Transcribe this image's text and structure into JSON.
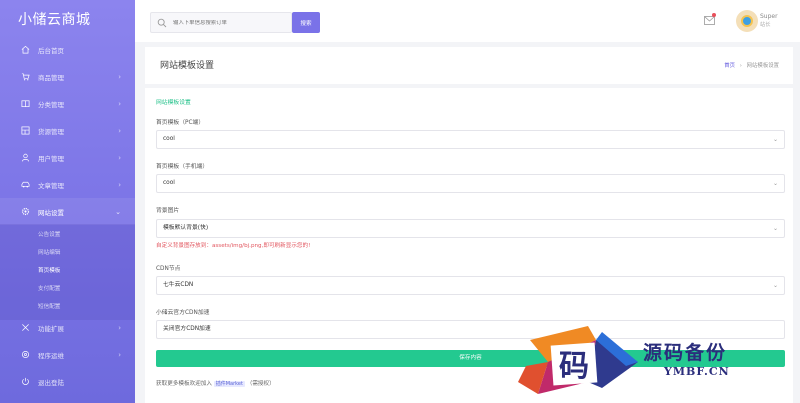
{
  "brand": "小储云商城",
  "sidebar": {
    "items": [
      {
        "label": "后台首页",
        "icon": "home-icon",
        "has_arrow": false
      },
      {
        "label": "商品管理",
        "icon": "cart-icon",
        "has_arrow": true
      },
      {
        "label": "分类管理",
        "icon": "book-icon",
        "has_arrow": true
      },
      {
        "label": "货源管理",
        "icon": "grid-icon",
        "has_arrow": true
      },
      {
        "label": "用户管理",
        "icon": "user-icon",
        "has_arrow": true
      },
      {
        "label": "文章管理",
        "icon": "car-icon",
        "has_arrow": true
      },
      {
        "label": "网站设置",
        "icon": "gear-icon",
        "has_arrow": true
      }
    ],
    "sub_items": [
      "公告设置",
      "网站编辑",
      "首页模板",
      "支付配置",
      "短信配置"
    ],
    "bottom_items": [
      {
        "label": "功能扩展",
        "icon": "tools-icon",
        "has_arrow": true
      },
      {
        "label": "程序运维",
        "icon": "settings-icon",
        "has_arrow": true
      },
      {
        "label": "退出登陆",
        "icon": "power-icon",
        "has_arrow": false
      }
    ],
    "arrow": "›",
    "arrow_open": "⌄"
  },
  "header": {
    "search_placeholder": "输入下单信息搜索订单",
    "search_button": "搜索",
    "user_name": "Super",
    "user_role": "站长"
  },
  "page": {
    "title": "网站模板设置",
    "crumb_home": "首页",
    "crumb_sep": "›",
    "crumb_current": "网站模板设置"
  },
  "form": {
    "section_title": "网站模板设置",
    "fields": [
      {
        "label": "首页模板（PC端）",
        "value": "cool"
      },
      {
        "label": "首页模板（手机端）",
        "value": "cool"
      },
      {
        "label": "背景图片",
        "value": "模板默认背景(快)"
      },
      {
        "label": "CDN节点",
        "value": "七牛云CDN"
      },
      {
        "label": "小储云官方CDN加速",
        "value": "关闭官方CDN加速"
      }
    ],
    "hint": "自定义背景图存放到：assets/img/bj.png,即可刷新显示您的!",
    "submit": "保存内容",
    "footer_prefix": "获取更多模板欢迎加入",
    "footer_tag": "插件Market",
    "footer_suffix": "（需授权）"
  },
  "watermark": {
    "text": "源码备份",
    "sub": "YMBF.CN",
    "char": "码"
  },
  "colors": {
    "sidebar": "#7b74e6",
    "accent": "#7a72e8",
    "green": "#23c990",
    "hint": "#e2565f"
  }
}
